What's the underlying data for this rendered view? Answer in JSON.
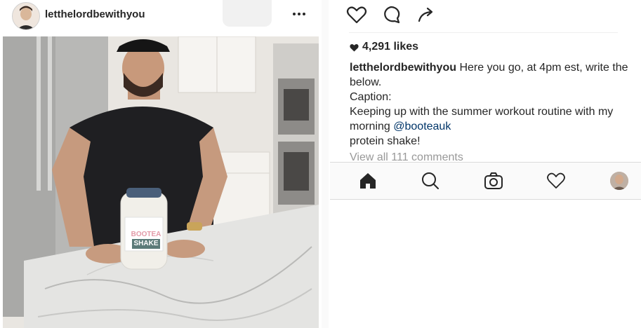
{
  "post": {
    "username": "letthelordbewithyou",
    "photo_product_label_top": "BOOTEA",
    "photo_product_label_bottom": "SHAKE"
  },
  "details": {
    "likes": "4,291 likes",
    "caption_user": "letthelordbewithyou",
    "caption_line1": " Here you go, at 4pm est, write the below.",
    "caption_line2": "Caption:",
    "caption_line3_before": "Keeping up with the summer workout routine with my morning ",
    "caption_mention": "@booteauk",
    "caption_line4": "protein shake!",
    "view_all_comments": "View all 111 comments"
  },
  "icons": {
    "actions": [
      "heart-icon",
      "comment-icon",
      "share-icon"
    ],
    "tabs": [
      "home-icon",
      "search-icon",
      "camera-icon",
      "heart-icon",
      "profile-avatar"
    ],
    "more": "more-options-icon"
  },
  "colors": {
    "text": "#262626",
    "mention": "#003569",
    "muted": "#999999",
    "tabbar_bg": "#fafafa"
  }
}
